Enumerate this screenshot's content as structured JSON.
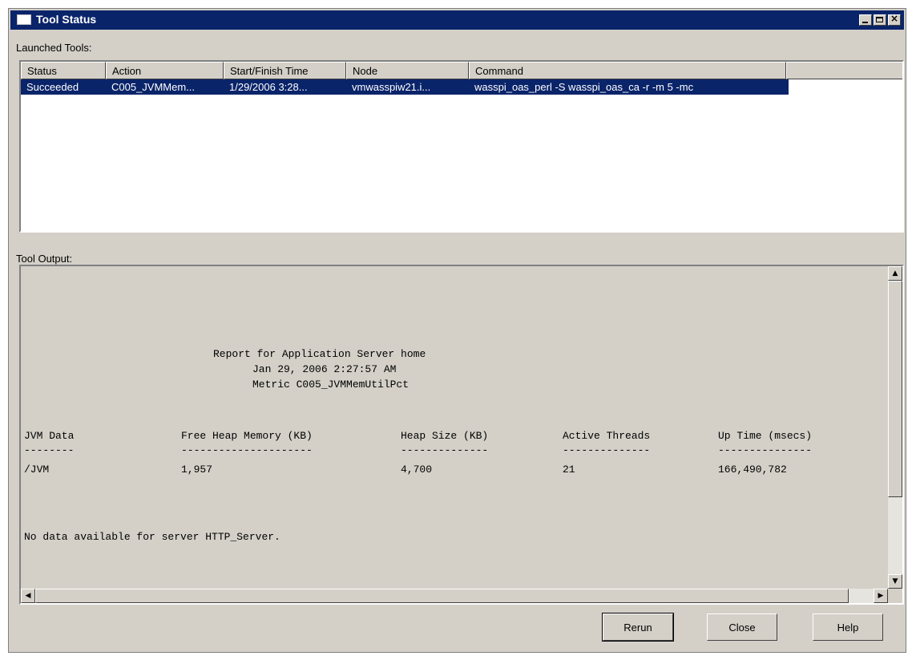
{
  "window": {
    "title": "Tool Status",
    "minimize_label": "",
    "maximize_label": "",
    "close_glyph": "×"
  },
  "launched_tools": {
    "label": "Launched Tools:",
    "columns": [
      "Status",
      "Action",
      "Start/Finish Time",
      "Node",
      "Command",
      ""
    ],
    "rows": [
      {
        "status": "Succeeded",
        "action": "C005_JVMMem...",
        "time": "1/29/2006 3:28...",
        "node": "vmwasspiw21.i...",
        "command": "wasspi_oas_perl -S wasspi_oas_ca -r -m 5 -mc"
      }
    ],
    "selected_color": "#0a246a"
  },
  "tool_output": {
    "label": "Tool Output:",
    "report": {
      "title": "Report for Application Server home",
      "date": "Jan 29, 2006 2:27:57 AM",
      "metric": "Metric C005_JVMMemUtilPct"
    },
    "table": {
      "headers": [
        "JVM Data",
        "Free Heap Memory (KB)",
        "Heap Size (KB)",
        "Active Threads",
        "Up Time (msecs)"
      ],
      "separators": [
        "--------",
        "---------------------",
        "--------------",
        "--------------",
        "---------------"
      ],
      "row": [
        "/JVM",
        "1,957",
        "4,700",
        "21",
        "166,490,782"
      ]
    },
    "message": "No data available for server HTTP_Server."
  },
  "buttons": {
    "rerun": "Rerun",
    "close": "Close",
    "help": "Help"
  },
  "icons": {
    "scroll_up": "▲",
    "scroll_down": "▼",
    "scroll_left": "◀",
    "scroll_right": "▶"
  },
  "colors": {
    "titlebar": "#0a246a",
    "face": "#d4d0c8"
  }
}
